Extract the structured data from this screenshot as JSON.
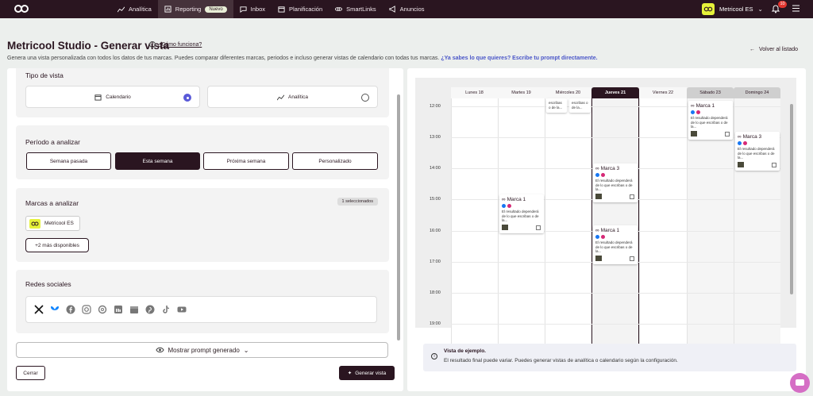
{
  "nav": {
    "items": [
      {
        "label": "Analítica",
        "icon": "chart-line-icon"
      },
      {
        "label": "Reporting",
        "icon": "report-icon",
        "badge": "Nuevo",
        "active": true
      },
      {
        "label": "Inbox",
        "icon": "chat-bubble-icon"
      },
      {
        "label": "Planificación",
        "icon": "calendar-icon"
      },
      {
        "label": "SmartLinks",
        "icon": "link-icon"
      },
      {
        "label": "Anuncios",
        "icon": "megaphone-icon"
      }
    ],
    "account_name": "Metricool ES",
    "notifications": "10"
  },
  "header": {
    "title": "Metricool Studio - Generar vista",
    "help_link": "¿Cómo funciona?",
    "subtitle": "Genera una vista personalizada con todos los datos de tus marcas. Puedes comparar diferentes marcas, periodos e incluso generar vistas de calendario con todas tus marcas.",
    "subtitle_link": "¿Ya sabes lo que quieres? Escribe tu prompt directamente.",
    "back_label": "Volver al listado"
  },
  "form": {
    "view_type": {
      "title": "Tipo de vista",
      "options": [
        {
          "label": "Calendario",
          "selected": true
        },
        {
          "label": "Analítica",
          "selected": false
        }
      ]
    },
    "period": {
      "title": "Período a analizar",
      "options": [
        "Semana pasada",
        "Esta semana",
        "Próxima semana",
        "Personalizado"
      ],
      "active_index": 1
    },
    "brands": {
      "title": "Marcas a analizar",
      "selected_badge": "1 seleccionados",
      "brand_name": "Metricool ES",
      "more_label": "+2 más disponibles"
    },
    "social": {
      "title": "Redes sociales",
      "icons": [
        "x-icon",
        "bluesky-icon",
        "facebook-icon",
        "instagram-icon",
        "threads-icon",
        "linkedin-icon",
        "google-business-icon",
        "pinterest-icon",
        "tiktok-icon",
        "youtube-icon"
      ]
    },
    "prompt_button": "Mostrar prompt generado",
    "close_button": "Cerrar",
    "generate_button": "Generar vista"
  },
  "calendar": {
    "days": [
      "Lunes 18",
      "Martes 19",
      "Miércoles 20",
      "Jueves 21",
      "Viernes 22",
      "Sábado 23",
      "Domingo 24"
    ],
    "today_index": 3,
    "hours": [
      "12:00",
      "13:00",
      "14:00",
      "15:00",
      "16:00",
      "17:00",
      "18:00",
      "19:00"
    ],
    "cards": [
      {
        "brand": "Marca 1",
        "text": "El resultado dependerá de lo que escribas o de la..."
      },
      {
        "brand": "Marca 3",
        "text": "El resultado dependerá de lo que escribas o de la..."
      },
      {
        "brand": "Marca 3",
        "text": "El resultado dependerá de lo que escribas o de la..."
      },
      {
        "brand": "Marca 1",
        "text": "El resultado dependerá de lo que escribas o de la..."
      },
      {
        "brand": "Marca 1",
        "text": "El resultado dependerá de lo que escribas o de la..."
      },
      {
        "brand": "",
        "text": "escribas o de la..."
      },
      {
        "brand": "",
        "text": "escribas o de la..."
      }
    ]
  },
  "note": {
    "title": "Vista de ejemplo.",
    "text": "El resultado final puede variar. Puedes generar vistas de analítica o calendario según la configuración."
  }
}
